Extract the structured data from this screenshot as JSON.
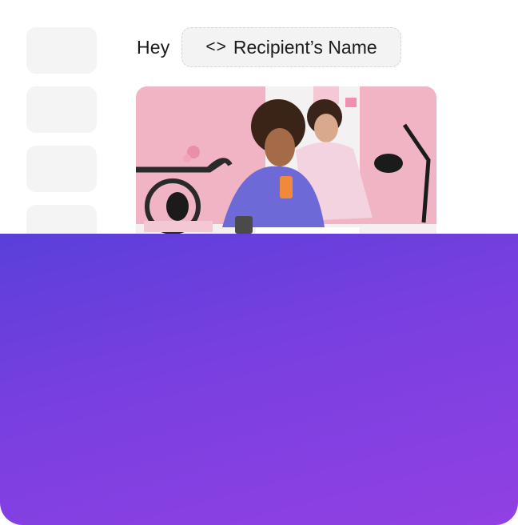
{
  "sidebar": {
    "tiles": 4
  },
  "message": {
    "greeting": "Hey",
    "token_icon": "<>",
    "token_label": "Recipient’s Name"
  },
  "photo": {
    "description_icon": "image-icon"
  },
  "colors": {
    "card_bg": "#ffffff",
    "tile_bg": "#f4f4f5",
    "chip_bg": "#f3f3f4",
    "panel_start": "#5a3fd9",
    "panel_end": "#9140e3",
    "photo_bg": "#f2b9c8"
  }
}
